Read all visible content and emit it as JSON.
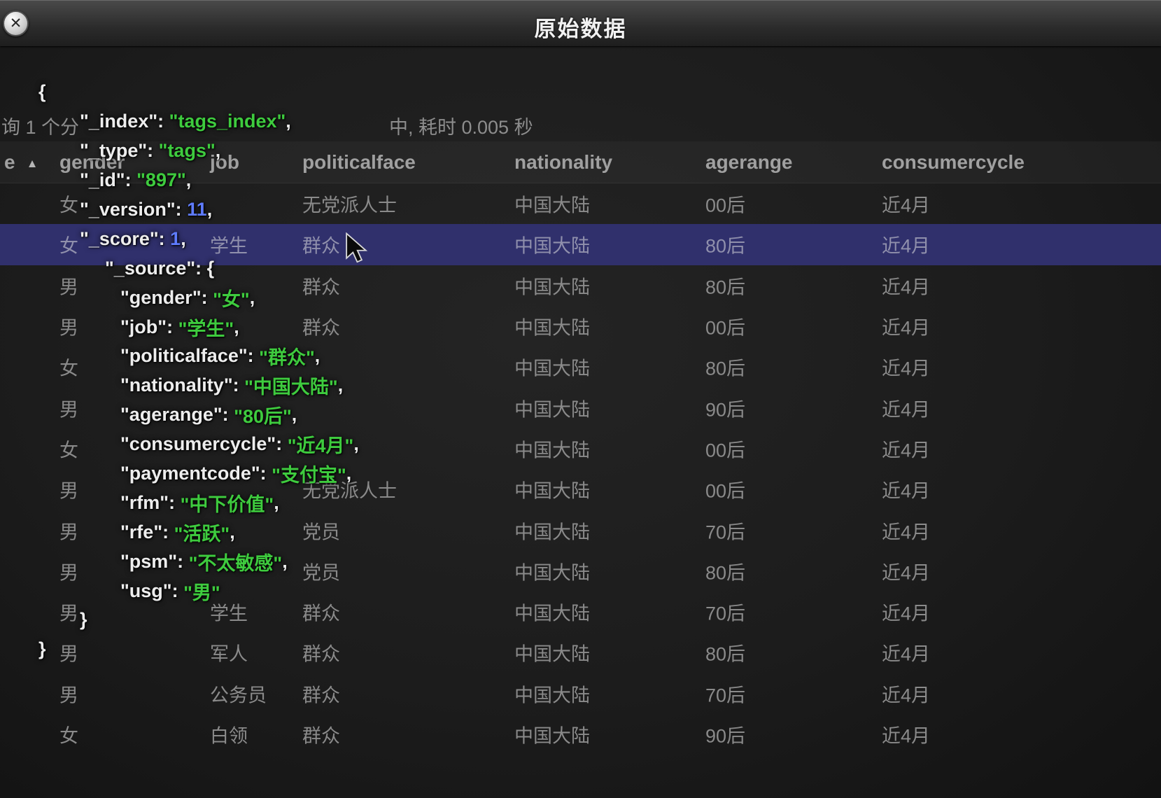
{
  "window": {
    "title": "原始数据",
    "close_icon": "✕"
  },
  "status": {
    "left_fragment": "询 1 个分",
    "right_fragment": "中, 耗时 0.005 秒"
  },
  "table": {
    "corner_label": "e",
    "sort_icon": "▲",
    "columns": [
      "gender",
      "job",
      "politicalface",
      "nationality",
      "agerange",
      "consumercycle"
    ],
    "selected_index": 1,
    "rows": [
      {
        "gender": "女",
        "job": "",
        "politicalface": "无党派人士",
        "nationality": "中国大陆",
        "agerange": "00后",
        "consumercycle": "近4月"
      },
      {
        "gender": "女",
        "job": "学生",
        "politicalface": "群众",
        "nationality": "中国大陆",
        "agerange": "80后",
        "consumercycle": "近4月"
      },
      {
        "gender": "男",
        "job": "",
        "politicalface": "群众",
        "nationality": "中国大陆",
        "agerange": "80后",
        "consumercycle": "近4月"
      },
      {
        "gender": "男",
        "job": "",
        "politicalface": "群众",
        "nationality": "中国大陆",
        "agerange": "00后",
        "consumercycle": "近4月"
      },
      {
        "gender": "女",
        "job": "",
        "politicalface": "",
        "nationality": "中国大陆",
        "agerange": "80后",
        "consumercycle": "近4月"
      },
      {
        "gender": "男",
        "job": "",
        "politicalface": "",
        "nationality": "中国大陆",
        "agerange": "90后",
        "consumercycle": "近4月"
      },
      {
        "gender": "女",
        "job": "",
        "politicalface": "",
        "nationality": "中国大陆",
        "agerange": "00后",
        "consumercycle": "近4月"
      },
      {
        "gender": "男",
        "job": "",
        "politicalface": "无党派人士",
        "nationality": "中国大陆",
        "agerange": "00后",
        "consumercycle": "近4月"
      },
      {
        "gender": "男",
        "job": "",
        "politicalface": "党员",
        "nationality": "中国大陆",
        "agerange": "70后",
        "consumercycle": "近4月"
      },
      {
        "gender": "男",
        "job": "",
        "politicalface": "党员",
        "nationality": "中国大陆",
        "agerange": "80后",
        "consumercycle": "近4月"
      },
      {
        "gender": "男",
        "job": "学生",
        "politicalface": "群众",
        "nationality": "中国大陆",
        "agerange": "70后",
        "consumercycle": "近4月"
      },
      {
        "gender": "男",
        "job": "军人",
        "politicalface": "群众",
        "nationality": "中国大陆",
        "agerange": "80后",
        "consumercycle": "近4月"
      },
      {
        "gender": "男",
        "job": "公务员",
        "politicalface": "群众",
        "nationality": "中国大陆",
        "agerange": "70后",
        "consumercycle": "近4月"
      },
      {
        "gender": "女",
        "job": "白领",
        "politicalface": "群众",
        "nationality": "中国大陆",
        "agerange": "90后",
        "consumercycle": "近4月"
      }
    ]
  },
  "json_doc": {
    "lines": [
      {
        "indent": 55,
        "seg": [
          {
            "c": "p",
            "t": "{"
          }
        ]
      },
      {
        "indent": 114,
        "seg": [
          {
            "c": "k",
            "t": "\"_index\""
          },
          {
            "c": "p",
            "t": ": "
          },
          {
            "c": "s",
            "t": "\"tags_index\""
          },
          {
            "c": "p",
            "t": ","
          }
        ]
      },
      {
        "indent": 114,
        "seg": [
          {
            "c": "k",
            "t": "\"_type\""
          },
          {
            "c": "p",
            "t": ": "
          },
          {
            "c": "s",
            "t": "\"tags\""
          },
          {
            "c": "p",
            "t": ","
          }
        ]
      },
      {
        "indent": 114,
        "seg": [
          {
            "c": "k",
            "t": "\"_id\""
          },
          {
            "c": "p",
            "t": ": "
          },
          {
            "c": "s",
            "t": "\"897\""
          },
          {
            "c": "p",
            "t": ","
          }
        ]
      },
      {
        "indent": 114,
        "seg": [
          {
            "c": "k",
            "t": "\"_version\""
          },
          {
            "c": "p",
            "t": ": "
          },
          {
            "c": "n",
            "t": "11"
          },
          {
            "c": "p",
            "t": ","
          }
        ]
      },
      {
        "indent": 114,
        "seg": [
          {
            "c": "k",
            "t": "\"_score\""
          },
          {
            "c": "p",
            "t": ": "
          },
          {
            "c": "n",
            "t": "1"
          },
          {
            "c": "p",
            "t": ","
          }
        ]
      },
      {
        "indent": 150,
        "seg": [
          {
            "c": "k",
            "t": "\"_source\""
          },
          {
            "c": "p",
            "t": ": {"
          }
        ]
      },
      {
        "indent": 172,
        "seg": [
          {
            "c": "k",
            "t": "\"gender\""
          },
          {
            "c": "p",
            "t": ": "
          },
          {
            "c": "s",
            "t": "\"女\""
          },
          {
            "c": "p",
            "t": ","
          }
        ]
      },
      {
        "indent": 172,
        "seg": [
          {
            "c": "k",
            "t": "\"job\""
          },
          {
            "c": "p",
            "t": ": "
          },
          {
            "c": "s",
            "t": "\"学生\""
          },
          {
            "c": "p",
            "t": ","
          }
        ]
      },
      {
        "indent": 172,
        "seg": [
          {
            "c": "k",
            "t": "\"politicalface\""
          },
          {
            "c": "p",
            "t": ": "
          },
          {
            "c": "s",
            "t": "\"群众\""
          },
          {
            "c": "p",
            "t": ","
          }
        ]
      },
      {
        "indent": 172,
        "seg": [
          {
            "c": "k",
            "t": "\"nationality\""
          },
          {
            "c": "p",
            "t": ": "
          },
          {
            "c": "s",
            "t": "\"中国大陆\""
          },
          {
            "c": "p",
            "t": ","
          }
        ]
      },
      {
        "indent": 172,
        "seg": [
          {
            "c": "k",
            "t": "\"agerange\""
          },
          {
            "c": "p",
            "t": ": "
          },
          {
            "c": "s",
            "t": "\"80后\""
          },
          {
            "c": "p",
            "t": ","
          }
        ]
      },
      {
        "indent": 172,
        "seg": [
          {
            "c": "k",
            "t": "\"consumercycle\""
          },
          {
            "c": "p",
            "t": ": "
          },
          {
            "c": "s",
            "t": "\"近4月\""
          },
          {
            "c": "p",
            "t": ","
          }
        ]
      },
      {
        "indent": 172,
        "seg": [
          {
            "c": "k",
            "t": "\"paymentcode\""
          },
          {
            "c": "p",
            "t": ": "
          },
          {
            "c": "s",
            "t": "\"支付宝\""
          },
          {
            "c": "p",
            "t": ","
          }
        ]
      },
      {
        "indent": 172,
        "seg": [
          {
            "c": "k",
            "t": "\"rfm\""
          },
          {
            "c": "p",
            "t": ": "
          },
          {
            "c": "s",
            "t": "\"中下价值\""
          },
          {
            "c": "p",
            "t": ","
          }
        ]
      },
      {
        "indent": 172,
        "seg": [
          {
            "c": "k",
            "t": "\"rfe\""
          },
          {
            "c": "p",
            "t": ": "
          },
          {
            "c": "s",
            "t": "\"活跃\""
          },
          {
            "c": "p",
            "t": ","
          }
        ]
      },
      {
        "indent": 172,
        "seg": [
          {
            "c": "k",
            "t": "\"psm\""
          },
          {
            "c": "p",
            "t": ": "
          },
          {
            "c": "s",
            "t": "\"不太敏感\""
          },
          {
            "c": "p",
            "t": ","
          }
        ]
      },
      {
        "indent": 172,
        "seg": [
          {
            "c": "k",
            "t": "\"usg\""
          },
          {
            "c": "p",
            "t": ": "
          },
          {
            "c": "s",
            "t": "\"男\""
          }
        ]
      },
      {
        "indent": 114,
        "seg": [
          {
            "c": "p",
            "t": "}"
          }
        ]
      },
      {
        "indent": 55,
        "seg": [
          {
            "c": "p",
            "t": "}"
          }
        ]
      }
    ]
  },
  "colors": {
    "json-key": "#ededed",
    "json-string": "#3ecb3e",
    "json-number": "#5f7cff",
    "selected-row-bg": "#30306c",
    "table-text": "#8a8a8a",
    "header-text": "#a0a0a0",
    "title-text": "#f2f2f2"
  }
}
